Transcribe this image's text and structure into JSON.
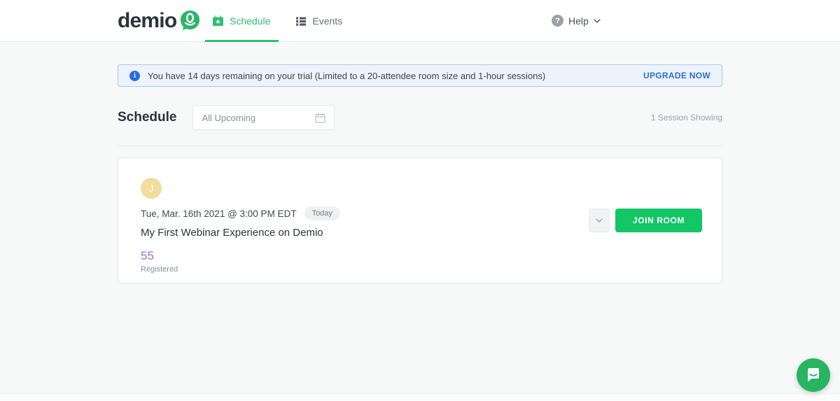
{
  "header": {
    "logo_text": "demio",
    "nav": [
      {
        "label": "Schedule",
        "active": true
      },
      {
        "label": "Events",
        "active": false
      }
    ],
    "help_label": "Help"
  },
  "trial_banner": {
    "message": "You have 14 days remaining on your trial (Limited to a 20-attendee room size and 1-hour sessions)",
    "action_label": "UPGRADE NOW"
  },
  "schedule": {
    "title": "Schedule",
    "filter_value": "All Upcoming",
    "sessions_count": "1 Session Showing"
  },
  "session_card": {
    "avatar_initial": "J",
    "datetime": "Tue, Mar. 16th 2021 @ 3:00 PM EDT",
    "badge": "Today",
    "title": "My First Webinar Experience on Demio",
    "registered_count": "55",
    "registered_label": "Registered",
    "join_button": "JOIN ROOM"
  },
  "colors": {
    "brand_green": "#2fbf71",
    "join_green": "#13c666",
    "banner_blue_bg": "#edf3fb",
    "banner_blue_border": "#a9c7ef",
    "link_blue": "#2a6ede",
    "registered_purple": "#9d71dd",
    "avatar_yellow": "#f2dc9e"
  }
}
